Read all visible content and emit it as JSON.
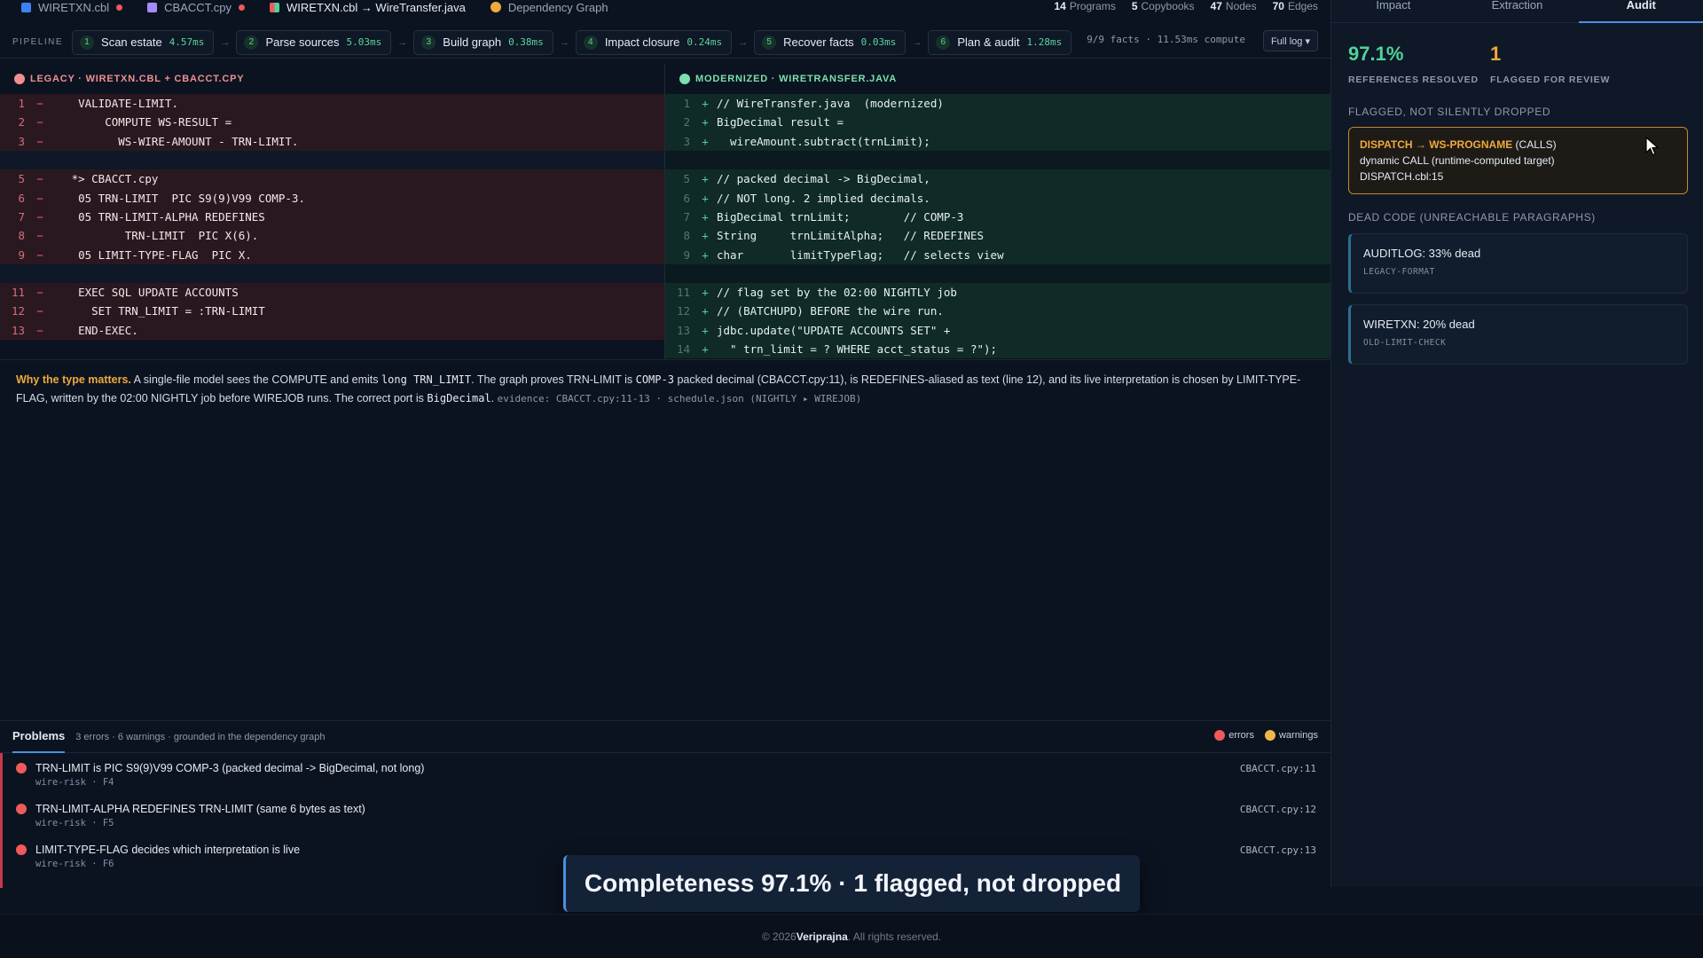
{
  "file_tabs": [
    {
      "label": "WIRETXN.cbl",
      "icon": "cobol-file-icon",
      "icon_color": "#3b82f6",
      "unsaved": true
    },
    {
      "label": "CBACCT.cpy",
      "icon": "copybook-file-icon",
      "icon_color": "#a78bfa",
      "unsaved": true
    },
    {
      "label": "WIRETXN.cbl → WireTransfer.java",
      "icon": "diff-file-icon",
      "icon_color": "#ef5a5a",
      "unsaved": false
    },
    {
      "label": "Dependency Graph",
      "icon": "graph-icon",
      "icon_color": "#f0a93b",
      "unsaved": false
    }
  ],
  "stats": [
    {
      "value": "14",
      "label": "Programs"
    },
    {
      "value": "5",
      "label": "Copybooks"
    },
    {
      "value": "47",
      "label": "Nodes"
    },
    {
      "value": "70",
      "label": "Edges"
    }
  ],
  "pipeline": {
    "label": "PIPELINE",
    "steps": [
      {
        "num": "1",
        "name": "Scan estate",
        "time": "4.57ms"
      },
      {
        "num": "2",
        "name": "Parse sources",
        "time": "5.03ms"
      },
      {
        "num": "3",
        "name": "Build graph",
        "time": "0.38ms"
      },
      {
        "num": "4",
        "name": "Impact closure",
        "time": "0.24ms"
      },
      {
        "num": "5",
        "name": "Recover facts",
        "time": "0.03ms"
      },
      {
        "num": "6",
        "name": "Plan & audit",
        "time": "1.28ms"
      }
    ],
    "meta": "9/9 facts · 11.53ms compute",
    "full_log": "Full log ▾"
  },
  "legacy": {
    "title": "LEGACY · WIRETXN.CBL + CBACCT.CPY",
    "lines": [
      {
        "n": "1",
        "t": "    VALIDATE-LIMIT."
      },
      {
        "n": "2",
        "t": "        COMPUTE WS-RESULT ="
      },
      {
        "n": "3",
        "t": "          WS-WIRE-AMOUNT - TRN-LIMIT."
      },
      {
        "n": "",
        "t": ""
      },
      {
        "n": "5",
        "t": "   *> CBACCT.cpy"
      },
      {
        "n": "6",
        "t": "    05 TRN-LIMIT  PIC S9(9)V99 COMP-3."
      },
      {
        "n": "7",
        "t": "    05 TRN-LIMIT-ALPHA REDEFINES"
      },
      {
        "n": "8",
        "t": "           TRN-LIMIT  PIC X(6)."
      },
      {
        "n": "9",
        "t": "    05 LIMIT-TYPE-FLAG  PIC X."
      },
      {
        "n": "",
        "t": ""
      },
      {
        "n": "11",
        "t": "    EXEC SQL UPDATE ACCOUNTS"
      },
      {
        "n": "12",
        "t": "      SET TRN_LIMIT = :TRN-LIMIT"
      },
      {
        "n": "13",
        "t": "    END-EXEC."
      }
    ]
  },
  "modern": {
    "title": "MODERNIZED · WIRETRANSFER.JAVA",
    "lines": [
      {
        "n": "1",
        "t": "// WireTransfer.java  (modernized)"
      },
      {
        "n": "2",
        "t": "BigDecimal result ="
      },
      {
        "n": "3",
        "t": "  wireAmount.subtract(trnLimit);"
      },
      {
        "n": "",
        "t": ""
      },
      {
        "n": "5",
        "t": "// packed decimal -> BigDecimal,"
      },
      {
        "n": "6",
        "t": "// NOT long. 2 implied decimals."
      },
      {
        "n": "7",
        "t": "BigDecimal trnLimit;        // COMP-3"
      },
      {
        "n": "8",
        "t": "String     trnLimitAlpha;   // REDEFINES"
      },
      {
        "n": "9",
        "t": "char       limitTypeFlag;   // selects view"
      },
      {
        "n": "",
        "t": ""
      },
      {
        "n": "11",
        "t": "// flag set by the 02:00 NIGHTLY job"
      },
      {
        "n": "12",
        "t": "// (BATCHUPD) BEFORE the wire run."
      },
      {
        "n": "13",
        "t": "jdbc.update(\"UPDATE ACCOUNTS SET\" +"
      },
      {
        "n": "14",
        "t": "  \" trn_limit = ? WHERE acct_status = ?\");"
      }
    ]
  },
  "explain": {
    "why": "Why the type matters.",
    "t1": " A single-file model sees the COMPUTE and emits ",
    "c1": "long TRN_LIMIT",
    "t2": ". The graph proves TRN-LIMIT is ",
    "c2": "COMP-3",
    "t3": " packed decimal (CBACCT.cpy:11), is REDEFINES-aliased as text (line 12), and its live interpretation is chosen by LIMIT-TYPE-FLAG, written by the 02:00 NIGHTLY job before WIREJOB runs. The correct port is ",
    "c3": "BigDecimal",
    "t4": ". ",
    "evidence": "evidence: CBACCT.cpy:11-13 · schedule.json (NIGHTLY ▸ WIREJOB)"
  },
  "problems": {
    "tab": "Problems",
    "summary": "3 errors · 6 warnings · grounded in the dependency graph",
    "legend_errors": "errors",
    "legend_warnings": "warnings",
    "error_color": "#ef5a5a",
    "warning_color": "#f0b84b",
    "items": [
      {
        "text": "TRN-LIMIT is PIC S9(9)V99 COMP-3 (packed decimal -> BigDecimal, not long)",
        "sub": "wire-risk · F4",
        "loc": "CBACCT.cpy:11"
      },
      {
        "text": "TRN-LIMIT-ALPHA REDEFINES TRN-LIMIT (same 6 bytes as text)",
        "sub": "wire-risk · F5",
        "loc": "CBACCT.cpy:12"
      },
      {
        "text": "LIMIT-TYPE-FLAG decides which interpretation is live",
        "sub": "wire-risk · F6",
        "loc": "CBACCT.cpy:13"
      }
    ]
  },
  "toast": "Completeness 97.1% · 1 flagged, not dropped",
  "footer": {
    "prefix": "© 2026 ",
    "brand": "Veriprajna",
    "suffix": ". All rights reserved."
  },
  "side": {
    "tabs": [
      "Impact",
      "Extraction",
      "Audit"
    ],
    "active_tab": "Audit",
    "metrics": [
      {
        "value": "97.1%",
        "label": "REFERENCES RESOLVED",
        "color": "#4fd39a"
      },
      {
        "value": "1",
        "label": "FLAGGED FOR REVIEW",
        "color": "#f0a93b"
      }
    ],
    "flag_section": "FLAGGED, NOT SILENTLY DROPPED",
    "flag": {
      "title": "DISPATCH → WS-PROGNAME",
      "kind": " (CALLS)",
      "desc": "dynamic CALL (runtime-computed target)",
      "loc": "DISPATCH.cbl:15"
    },
    "dead_section": "DEAD CODE (UNREACHABLE PARAGRAPHS)",
    "dead": [
      {
        "title": "AUDITLOG: 33% dead",
        "sub": "LEGACY-FORMAT"
      },
      {
        "title": "WIRETXN: 20% dead",
        "sub": "OLD-LIMIT-CHECK"
      }
    ]
  }
}
